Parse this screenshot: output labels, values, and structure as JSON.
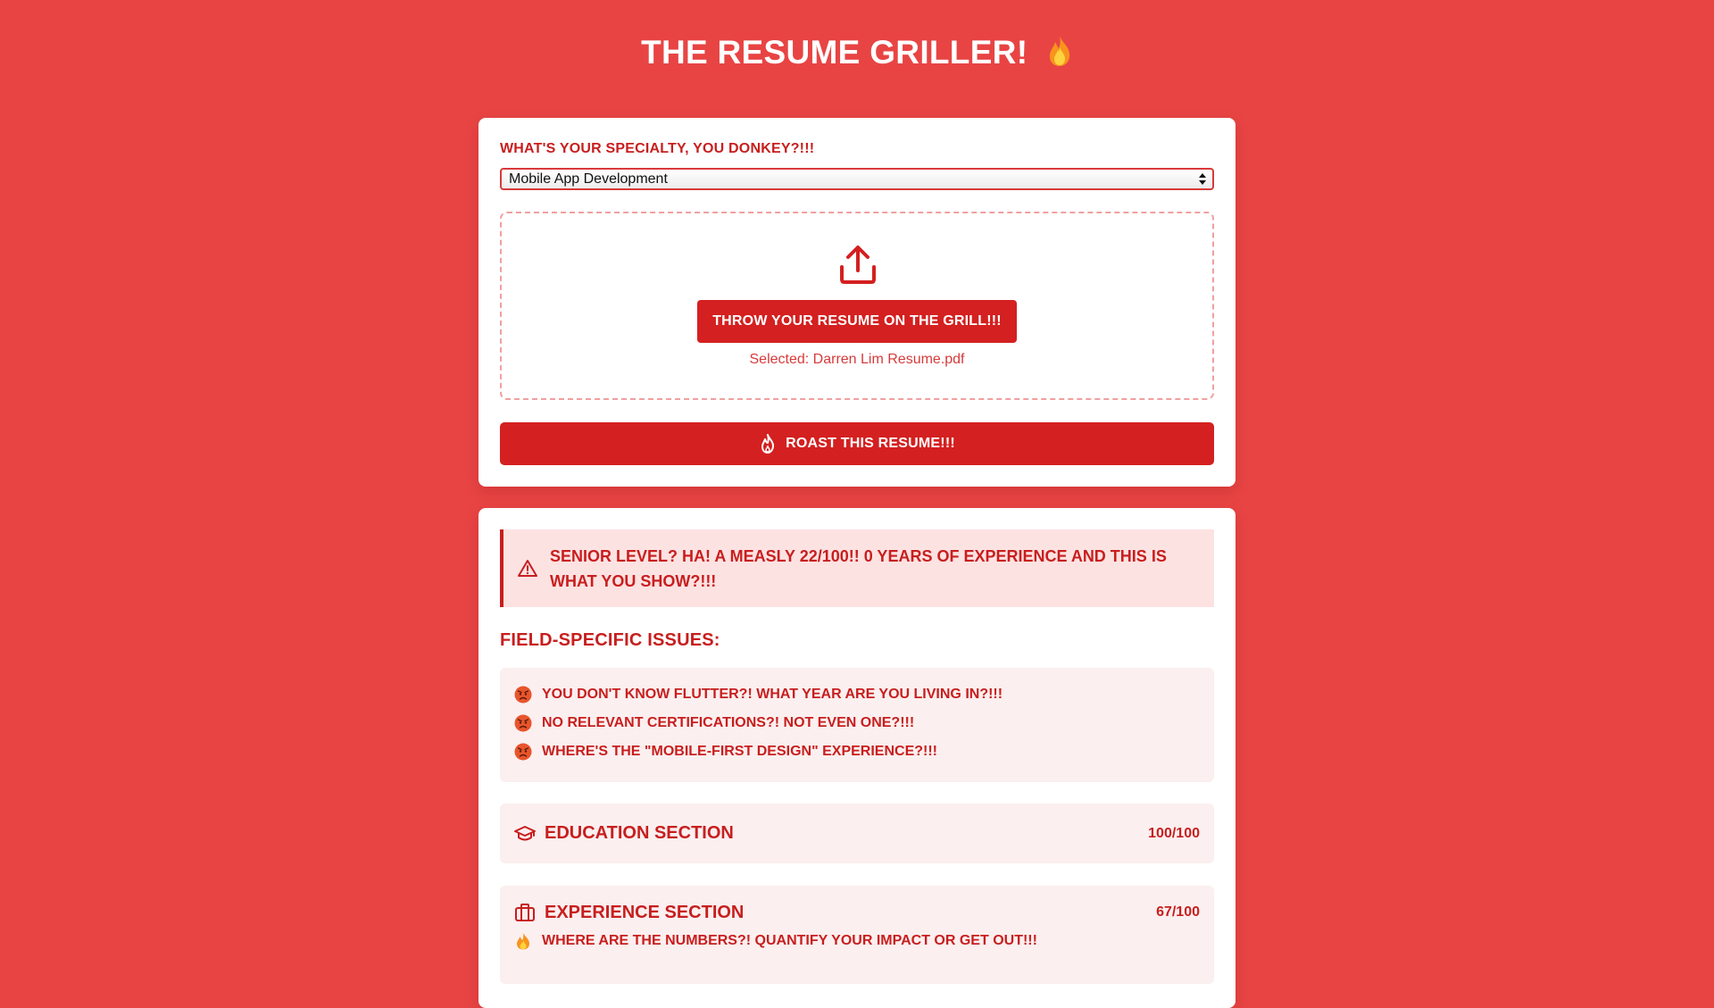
{
  "app": {
    "title": "THE RESUME GRILLER!"
  },
  "colors": {
    "background": "#e84444",
    "accent": "#d42020",
    "text_red": "#c81e1e",
    "card": "#ffffff",
    "panel_pink": "#fbefef",
    "alert_pink": "#fde2e2"
  },
  "upload_form": {
    "specialty_label": "WHAT'S YOUR SPECIALTY, YOU DONKEY?!!!",
    "specialty_selected": "Mobile App Development",
    "upload_icon": "upload-icon",
    "upload_button_label": "THROW YOUR RESUME ON THE GRILL!!!",
    "selected_file_text": "Selected: Darren Lim Resume.pdf",
    "roast_button_label": "ROAST THIS RESUME!!!",
    "roast_icon": "flame-icon"
  },
  "results": {
    "alert_icon": "warning-triangle-icon",
    "alert_text": "SENIOR LEVEL? HA! A MEASLY 22/100!! 0 YEARS OF EXPERIENCE AND THIS IS WHAT YOU SHOW?!!!",
    "field_issues_heading": "FIELD-SPECIFIC ISSUES:",
    "field_issues": [
      "YOU DON'T KNOW FLUTTER?! WHAT YEAR ARE YOU LIVING IN?!!!",
      "NO RELEVANT CERTIFICATIONS?! NOT EVEN ONE?!!!",
      "WHERE'S THE \"MOBILE-FIRST DESIGN\" EXPERIENCE?!!!"
    ],
    "sections": [
      {
        "title": "EDUCATION SECTION",
        "score": "100/100",
        "icon": "graduation-cap-icon"
      },
      {
        "title": "EXPERIENCE SECTION",
        "score": "67/100",
        "icon": "briefcase-icon",
        "note": "WHERE ARE THE NUMBERS?! QUANTIFY YOUR IMPACT OR GET OUT!!!"
      }
    ]
  }
}
